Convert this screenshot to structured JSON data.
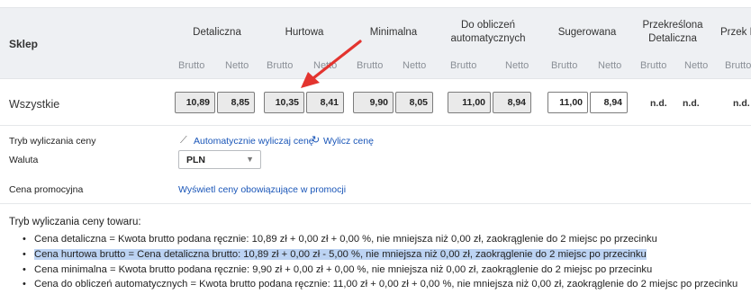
{
  "header": {
    "sklep": "Sklep",
    "groups": [
      "Detaliczna",
      "Hurtowa",
      "Minimalna",
      "Do obliczeń automatycznych",
      "Sugerowana",
      "Przekreślona Detaliczna",
      "Przek Hu"
    ],
    "brutto": "Brutto",
    "netto": "Netto"
  },
  "row": {
    "store": "Wszystkie",
    "detal_brutto": "10,89",
    "detal_netto": "8,85",
    "hurt_brutto": "10,35",
    "hurt_netto": "8,41",
    "min_brutto": "9,90",
    "min_netto": "8,05",
    "auto_brutto": "11,00",
    "auto_netto": "8,94",
    "sug_brutto": "11,00",
    "sug_netto": "8,94",
    "nd": "n.d."
  },
  "settings": {
    "tryb_label": "Tryb wyliczania ceny",
    "auto_link": "Automatycznie wyliczaj cenę",
    "calc_link": "Wylicz cenę",
    "waluta_label": "Waluta",
    "waluta_value": "PLN",
    "promo_label": "Cena promocyjna",
    "promo_link": "Wyświetl ceny obowiązujące w promocji"
  },
  "info": {
    "title": "Tryb wyliczania ceny towaru:",
    "lines": [
      "Cena detaliczna = Kwota brutto podana ręcznie: 10,89 zł + 0,00 zł + 0,00 %, nie mniejsza niż 0,00 zł, zaokrąglenie do 2 miejsc po przecinku",
      "Cena hurtowa brutto = Cena detaliczna brutto: 10,89 zł + 0,00 zł - 5,00 %, nie mniejsza niż 0,00 zł, zaokrąglenie do 2 miejsc po przecinku",
      "Cena minimalna = Kwota brutto podana ręcznie: 9,90 zł + 0,00 zł + 0,00 %, nie mniejsza niż 0,00 zł, zaokrąglenie do 2 miejsc po przecinku",
      "Cena do obliczeń automatycznych = Kwota brutto podana ręcznie: 11,00 zł + 0,00 zł + 0,00 %, nie mniejsza niż 0,00 zł, zaokrąglenie do 2 miejsc po przecinku"
    ]
  },
  "colors": {
    "link": "#1a56b8",
    "highlight": "#bcd3f3",
    "arrow": "#e3342f",
    "header_bg": "#eef0f3"
  }
}
